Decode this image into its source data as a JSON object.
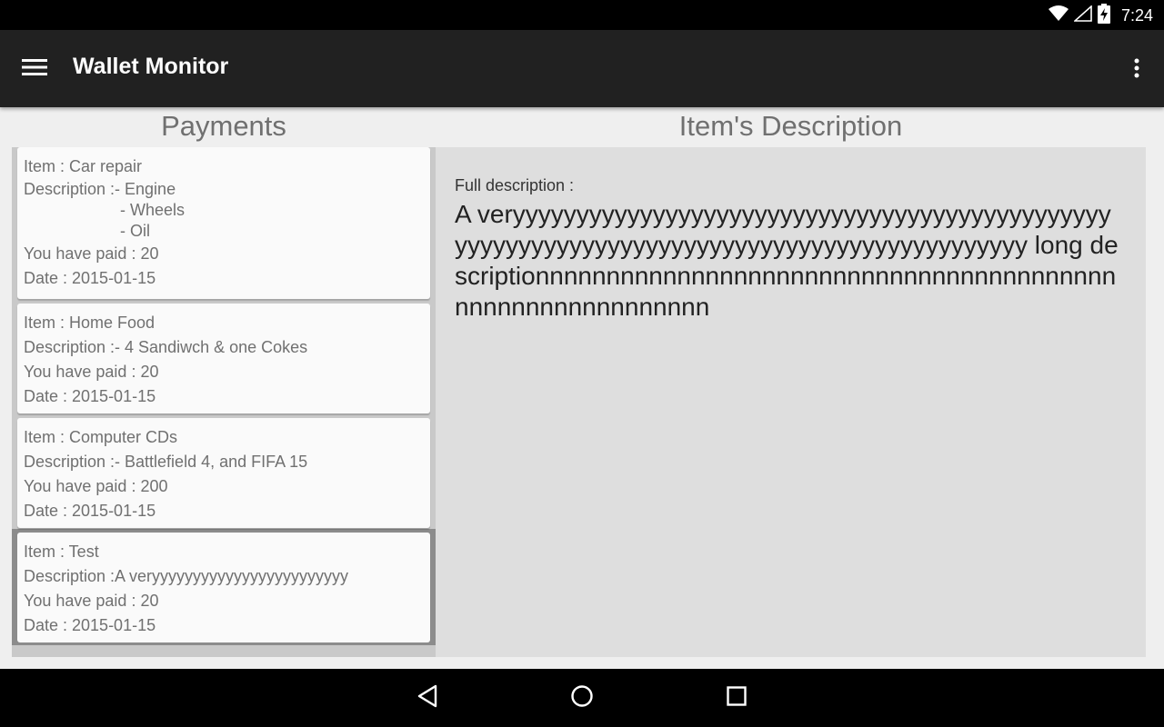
{
  "status_bar": {
    "time": "7:24",
    "icons": [
      "wifi-icon",
      "signal-icon",
      "battery-charging-icon"
    ]
  },
  "app_bar": {
    "title": "Wallet Monitor",
    "menu_icon": "hamburger-menu-icon",
    "overflow_icon": "overflow-menu-icon"
  },
  "payments": {
    "title": "Payments",
    "items": [
      {
        "item": "Item : Car repair",
        "description_lines": [
          "Description :- Engine",
          "- Wheels",
          "- Oil"
        ],
        "paid": "You have paid : 20",
        "date": "Date : 2015-01-15"
      },
      {
        "item": "Item : Home Food",
        "description_lines": [
          "Description :- 4 Sandiwch & one Cokes"
        ],
        "paid": "You have paid : 20",
        "date": "Date : 2015-01-15"
      },
      {
        "item": "Item : Computer CDs",
        "description_lines": [
          "Description :- Battlefield 4, and FIFA 15"
        ],
        "paid": "You have paid : 200",
        "date": "Date : 2015-01-15"
      },
      {
        "item": "Item : Test",
        "description_lines": [
          "Description :A veryyyyyyyyyyyyyyyyyyyyyyyy"
        ],
        "paid": "You have paid : 20",
        "date": "Date : 2015-01-15"
      }
    ]
  },
  "description_panel": {
    "title": "Item's Description",
    "label": "Full description :",
    "text": "A veryyyyyyyyyyyyyyyyyyyyyyyyyyyyyyyyyyyyyyyyyyyyyyyyyyyyyyyyyyyyyyyyyyyyyyyyyyyyyyyyyyyyyyyyyyyy long descriptionnnnnnnnnnnnnnnnnnnnnnnnnnnnnnnnnnnnnnnnnnnnnnnnnnnnnnnnnnn"
  },
  "nav_bar": {
    "icons": [
      "back-icon",
      "home-icon",
      "recents-icon"
    ]
  },
  "colors": {
    "app_bar": "#212121",
    "status_bar": "#000000",
    "list_bg": "#c9c9c9",
    "card_bg": "#fafafa",
    "desc_bg": "#dedede",
    "title_text": "#707070"
  }
}
